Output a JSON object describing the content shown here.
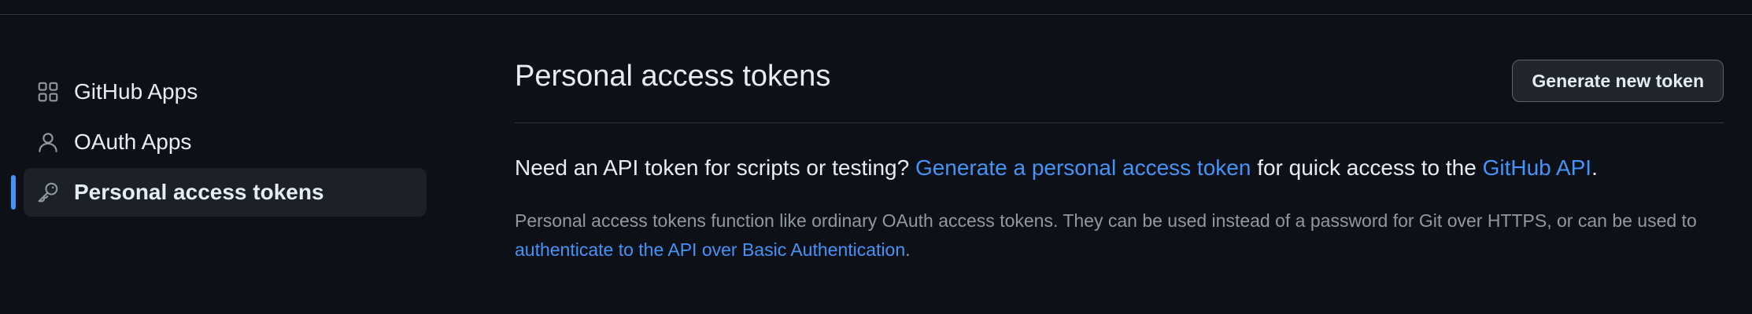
{
  "sidebar": {
    "items": [
      {
        "label": "GitHub Apps",
        "icon": "apps-grid-icon",
        "active": false
      },
      {
        "label": "OAuth Apps",
        "icon": "person-icon",
        "active": false
      },
      {
        "label": "Personal access tokens",
        "icon": "key-icon",
        "active": true
      }
    ]
  },
  "main": {
    "title": "Personal access tokens",
    "generate_button_label": "Generate new token",
    "lead": {
      "before": "Need an API token for scripts or testing? ",
      "link1": "Generate a personal access token",
      "middle": " for quick access to the ",
      "link2": "GitHub API",
      "after": "."
    },
    "description": {
      "text": "Personal access tokens function like ordinary OAuth access tokens. They can be used instead of a password for Git over HTTPS, or can be used to ",
      "link": "authenticate to the API over Basic Authentication",
      "after": "."
    }
  },
  "colors": {
    "background": "#0d1117",
    "text": "#e6edf3",
    "muted_text": "#9198a1",
    "link": "#4493f8",
    "accent_marker": "#4493f8",
    "border": "#30363d"
  }
}
